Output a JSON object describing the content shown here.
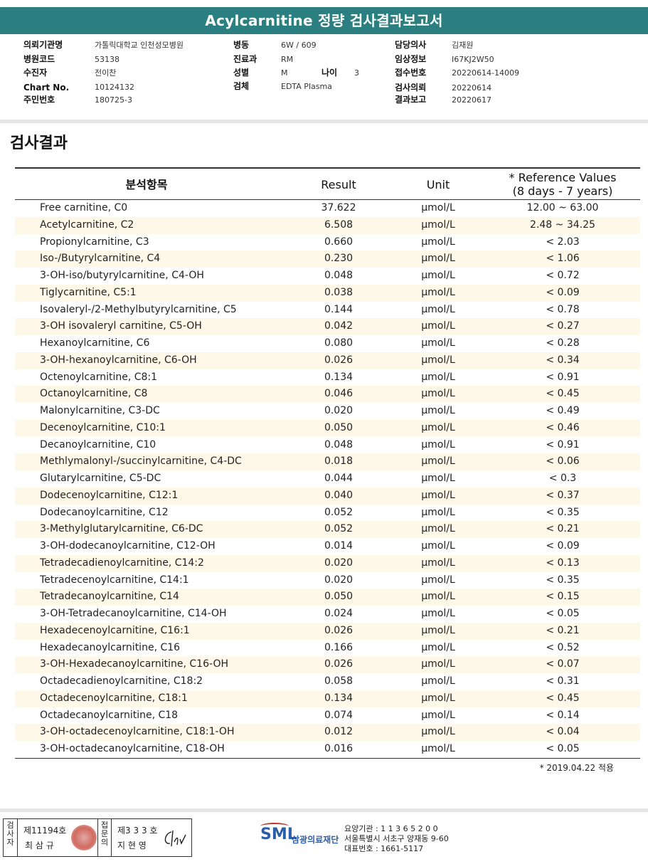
{
  "report_title": "Acylcarnitine 정량 검사결과보고서",
  "header": {
    "col1": [
      {
        "label": "의뢰기관명",
        "value": "가톨릭대학교 인천성모병원"
      },
      {
        "label": "병원코드",
        "value": "53138"
      },
      {
        "label": "수진자",
        "value": "전이찬"
      },
      {
        "label": "Chart No.",
        "value": "10124132"
      },
      {
        "label": "주민번호",
        "value": "180725-3"
      }
    ],
    "col2": [
      {
        "label": "병동",
        "value": "6W / 609"
      },
      {
        "label": "진료과",
        "value": "RM"
      },
      {
        "label": "성별",
        "value": "M"
      },
      {
        "label": "검체",
        "value": "EDTA Plasma"
      }
    ],
    "age_label": "나이",
    "age_value": "3",
    "col3": [
      {
        "label": "담당의사",
        "value": "김재원"
      },
      {
        "label": "임상정보",
        "value": "I67KJ2W50"
      },
      {
        "label": "접수번호",
        "value": "20220614-14009"
      },
      {
        "label": "검사의뢰",
        "value": "20220614"
      },
      {
        "label": "결과보고",
        "value": "20220617"
      }
    ]
  },
  "section_title": "검사결과",
  "table": {
    "headers": {
      "item": "분석항목",
      "result": "Result",
      "unit": "Unit",
      "ref_line1": "* Reference Values",
      "ref_line2": "(8 days - 7 years)"
    },
    "rows": [
      {
        "name": "Free carnitine, C0",
        "result": "37.622",
        "unit": "μmol/L",
        "ref": "12.00 ~ 63.00"
      },
      {
        "name": "Acetylcarnitine, C2",
        "result": "6.508",
        "unit": "μmol/L",
        "ref": "2.48 ~ 34.25"
      },
      {
        "name": "Propionylcarnitine, C3",
        "result": "0.660",
        "unit": "μmol/L",
        "ref": "< 2.03"
      },
      {
        "name": "Iso-/Butyrylcarnitine, C4",
        "result": "0.230",
        "unit": "μmol/L",
        "ref": "< 1.06"
      },
      {
        "name": "3-OH-iso/butyrylcarnitine, C4-OH",
        "result": "0.048",
        "unit": "μmol/L",
        "ref": "< 0.72"
      },
      {
        "name": "Tiglycarnitine, C5:1",
        "result": "0.038",
        "unit": "μmol/L",
        "ref": "< 0.09"
      },
      {
        "name": "Isovaleryl-/2-Methylbutyrylcarnitine, C5",
        "result": "0.144",
        "unit": "μmol/L",
        "ref": "< 0.78"
      },
      {
        "name": "3-OH isovaleryl carnitine, C5-OH",
        "result": "0.042",
        "unit": "μmol/L",
        "ref": "< 0.27"
      },
      {
        "name": "Hexanoylcarnitine, C6",
        "result": "0.080",
        "unit": "μmol/L",
        "ref": "< 0.28"
      },
      {
        "name": "3-OH-hexanoylcarnitine, C6-OH",
        "result": "0.026",
        "unit": "μmol/L",
        "ref": "< 0.34"
      },
      {
        "name": "Octenoylcarnitine, C8:1",
        "result": "0.134",
        "unit": "μmol/L",
        "ref": "< 0.91"
      },
      {
        "name": "Octanoylcarnitine, C8",
        "result": "0.046",
        "unit": "μmol/L",
        "ref": "< 0.45"
      },
      {
        "name": "Malonylcarnitine, C3-DC",
        "result": "0.020",
        "unit": "μmol/L",
        "ref": "< 0.49"
      },
      {
        "name": "Decenoylcarnitine, C10:1",
        "result": "0.050",
        "unit": "μmol/L",
        "ref": "< 0.46"
      },
      {
        "name": "Decanoylcarnitine, C10",
        "result": "0.048",
        "unit": "μmol/L",
        "ref": "< 0.91"
      },
      {
        "name": "Methlymalonyl-/succinylcarnitine, C4-DC",
        "result": "0.018",
        "unit": "μmol/L",
        "ref": "< 0.06"
      },
      {
        "name": "Glutarylcarnitine, C5-DC",
        "result": "0.044",
        "unit": "μmol/L",
        "ref": "< 0.3"
      },
      {
        "name": "Dodecenoylcarnitine, C12:1",
        "result": "0.040",
        "unit": "μmol/L",
        "ref": "< 0.37"
      },
      {
        "name": "Dodecanoylcarnitine, C12",
        "result": "0.052",
        "unit": "μmol/L",
        "ref": "< 0.35"
      },
      {
        "name": "3-Methylglutarylcarnitine, C6-DC",
        "result": "0.052",
        "unit": "μmol/L",
        "ref": "< 0.21"
      },
      {
        "name": "3-OH-dodecanoylcarnitine, C12-OH",
        "result": "0.014",
        "unit": "μmol/L",
        "ref": "< 0.09"
      },
      {
        "name": "Tetradecadienoylcarnitine, C14:2",
        "result": "0.020",
        "unit": "μmol/L",
        "ref": "< 0.13"
      },
      {
        "name": "Tetradecenoylcarnitine, C14:1",
        "result": "0.020",
        "unit": "μmol/L",
        "ref": "< 0.35"
      },
      {
        "name": "Tetradecanoylcarnitine, C14",
        "result": "0.050",
        "unit": "μmol/L",
        "ref": "< 0.15"
      },
      {
        "name": "3-OH-Tetradecanoylcarnitine, C14-OH",
        "result": "0.024",
        "unit": "μmol/L",
        "ref": "< 0.05"
      },
      {
        "name": "Hexadecenoylcarnitine, C16:1",
        "result": "0.026",
        "unit": "μmol/L",
        "ref": "< 0.21"
      },
      {
        "name": "Hexadecanoylcarnitine, C16",
        "result": "0.166",
        "unit": "μmol/L",
        "ref": "< 0.52"
      },
      {
        "name": "3-OH-Hexadecanoylcarnitine, C16-OH",
        "result": "0.026",
        "unit": "μmol/L",
        "ref": "< 0.07"
      },
      {
        "name": "Octadecadienoylcarnitine, C18:2",
        "result": "0.058",
        "unit": "μmol/L",
        "ref": "< 0.31"
      },
      {
        "name": "Octadecenoylcarnitine, C18:1",
        "result": "0.134",
        "unit": "μmol/L",
        "ref": "< 0.45"
      },
      {
        "name": "Octadecanoylcarnitine, C18",
        "result": "0.074",
        "unit": "μmol/L",
        "ref": "< 0.14"
      },
      {
        "name": "3-OH-octadecenoylcarnitine, C18:1-OH",
        "result": "0.012",
        "unit": "μmol/L",
        "ref": "< 0.04"
      },
      {
        "name": "3-OH-octadecanoylcarnitine, C18-OH",
        "result": "0.016",
        "unit": "μmol/L",
        "ref": "< 0.05"
      }
    ]
  },
  "footnote": "* 2019.04.22 적용",
  "sign": {
    "examiner_label": [
      "검",
      "사",
      "자"
    ],
    "examiner_no": "제11194호",
    "examiner_name": "최 삼 규",
    "reviewer_label": [
      "접",
      "문",
      "의"
    ],
    "reviewer_no": "제3 3 3 호",
    "reviewer_name": "지 현 영"
  },
  "org": {
    "logo": "SML",
    "name": "삼광의료재단",
    "line1": "요양기관 : 1 1 3 6 5 2 0 0",
    "line2": "서울특별시 서초구 양재동 9-60",
    "line3": "대표번호 : 1661-5117"
  },
  "colors": {
    "title_bar": "#2b7f80",
    "alt_row": "#fdf8e8",
    "logo_blue": "#2a5ea8",
    "seal_red": "#c0392b"
  }
}
